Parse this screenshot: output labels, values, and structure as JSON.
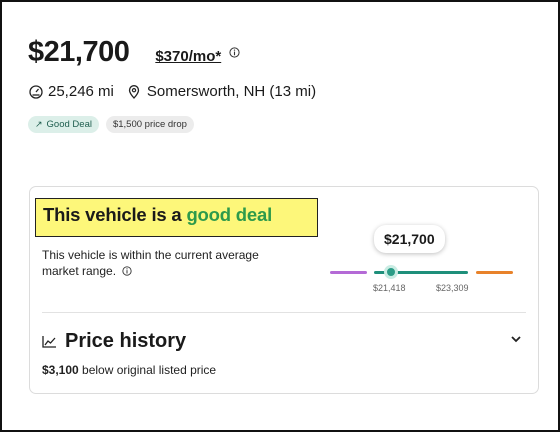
{
  "listing": {
    "price": "$21,700",
    "monthly": "$370/mo*",
    "mileage": "25,246 mi",
    "location": "Somersworth, NH (13 mi)",
    "badges": {
      "deal": "Good Deal",
      "drop": "$1,500 price drop"
    }
  },
  "deal_card": {
    "title_prefix": "This vehicle is a ",
    "title_accent": "good deal",
    "description": "This vehicle is within the current average market range.",
    "marker_price": "$21,700",
    "range_low": "$21,418",
    "range_high": "$23,309",
    "colors": {
      "accent_green": "#2d9a4b",
      "highlight": "#fdf77a",
      "teal": "#1e8f7a",
      "purple": "#b46ad6",
      "orange": "#e8822a"
    }
  },
  "price_history": {
    "title": "Price history",
    "amount": "$3,100",
    "subtitle": " below original listed price"
  },
  "icons": [
    "speedometer-icon",
    "location-pin-icon",
    "info-icon",
    "trend-arrow-icon",
    "chart-icon",
    "chevron-down-icon"
  ]
}
